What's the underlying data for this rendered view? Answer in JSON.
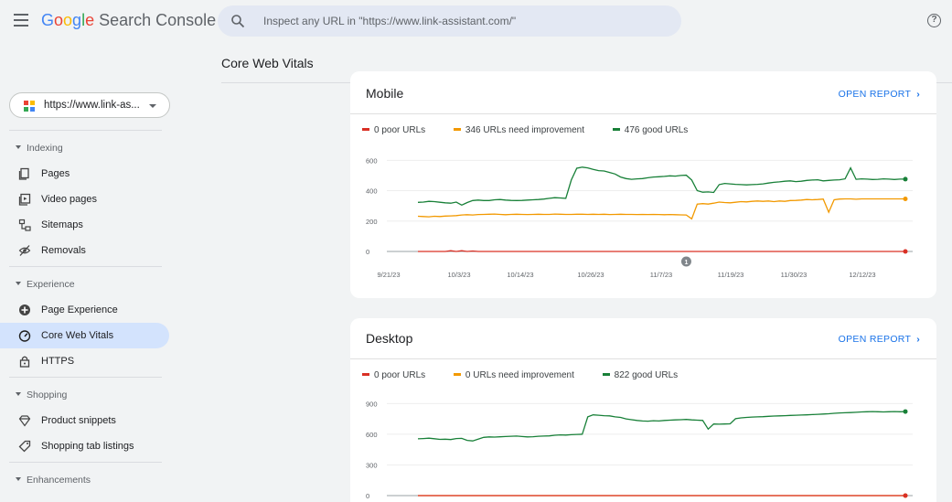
{
  "header": {
    "logo_google": "Google",
    "logo_product": "Search Console",
    "search_placeholder": "Inspect any URL in \"https://www.link-assistant.com/\"",
    "help_glyph": "?"
  },
  "page_title": "Core Web Vitals",
  "sidebar": {
    "property": "https://www.link-as...",
    "sections": [
      {
        "label": "Indexing",
        "items": [
          {
            "label": "Pages",
            "icon": "pages-icon"
          },
          {
            "label": "Video pages",
            "icon": "video-pages-icon"
          },
          {
            "label": "Sitemaps",
            "icon": "sitemaps-icon"
          },
          {
            "label": "Removals",
            "icon": "removals-icon"
          }
        ]
      },
      {
        "label": "Experience",
        "items": [
          {
            "label": "Page Experience",
            "icon": "page-experience-icon"
          },
          {
            "label": "Core Web Vitals",
            "icon": "speedometer-icon",
            "active": true
          },
          {
            "label": "HTTPS",
            "icon": "lock-icon"
          }
        ]
      },
      {
        "label": "Shopping",
        "items": [
          {
            "label": "Product snippets",
            "icon": "diamond-icon"
          },
          {
            "label": "Shopping tab listings",
            "icon": "tag-icon"
          }
        ]
      },
      {
        "label": "Enhancements",
        "items": []
      }
    ]
  },
  "colors": {
    "poor": "#d93025",
    "needs_improvement": "#f29900",
    "good": "#188038",
    "accent": "#1a73e8",
    "active_nav": "#d3e3fd"
  },
  "cards": [
    {
      "title": "Mobile",
      "open_report": "OPEN REPORT",
      "legend": [
        "0 poor URLs",
        "346 URLs need improvement",
        "476 good URLs"
      ],
      "annotation": "1",
      "chart_data": {
        "type": "line",
        "x_ticks": [
          "9/21/23",
          "10/3/23",
          "10/14/23",
          "10/26/23",
          "11/7/23",
          "11/19/23",
          "11/30/23",
          "12/12/23"
        ],
        "y_ticks": [
          0,
          200,
          400,
          600
        ],
        "ylim": [
          0,
          620
        ],
        "annotation_index": 49,
        "series": [
          {
            "name": "0 poor URLs",
            "color": "#d93025",
            "values": [
              0,
              0,
              0,
              0,
              0,
              0,
              5,
              0,
              5,
              0,
              3,
              0,
              0,
              0,
              0,
              0,
              0,
              0,
              0,
              0,
              0,
              0,
              0,
              0,
              0,
              0,
              0,
              0,
              0,
              0,
              0,
              0,
              0,
              0,
              0,
              0,
              0,
              0,
              0,
              0,
              0,
              0,
              0,
              0,
              0,
              0,
              0,
              0,
              0,
              0,
              0,
              0,
              0,
              0,
              0,
              0,
              0,
              0,
              0,
              0,
              0,
              0,
              0,
              0,
              0,
              0,
              0,
              0,
              0,
              0,
              0,
              0,
              0,
              0,
              0,
              0,
              0,
              0,
              0,
              0,
              0,
              0,
              0,
              0,
              0,
              0,
              0,
              0,
              0,
              0
            ]
          },
          {
            "name": "346 URLs need improvement",
            "color": "#f29900",
            "values": [
              232,
              230,
              228,
              232,
              230,
              233,
              234,
              236,
              240,
              242,
              240,
              243,
              244,
              245,
              246,
              244,
              242,
              244,
              245,
              244,
              243,
              244,
              245,
              244,
              244,
              246,
              245,
              244,
              244,
              245,
              245,
              244,
              245,
              244,
              245,
              243,
              244,
              245,
              244,
              244,
              243,
              244,
              243,
              244,
              243,
              242,
              243,
              242,
              241,
              240,
              215,
              312,
              315,
              312,
              318,
              325,
              322,
              320,
              324,
              328,
              326,
              330,
              332,
              330,
              332,
              328,
              332,
              330,
              335,
              336,
              338,
              342,
              340,
              342,
              345,
              258,
              340,
              345,
              346,
              346,
              344,
              346,
              346,
              346,
              346,
              346,
              346,
              346,
              346,
              346
            ]
          },
          {
            "name": "476 good URLs",
            "color": "#188038",
            "values": [
              323,
              325,
              330,
              328,
              324,
              320,
              318,
              325,
              305,
              322,
              335,
              338,
              335,
              335,
              340,
              342,
              338,
              336,
              335,
              336,
              338,
              340,
              342,
              345,
              350,
              354,
              352,
              350,
              470,
              548,
              555,
              550,
              540,
              532,
              530,
              520,
              510,
              490,
              480,
              475,
              478,
              480,
              485,
              490,
              492,
              494,
              498,
              496,
              500,
              502,
              470,
              400,
              390,
              392,
              388,
              440,
              448,
              445,
              442,
              440,
              438,
              440,
              442,
              445,
              450,
              455,
              458,
              462,
              465,
              460,
              462,
              468,
              470,
              472,
              465,
              468,
              470,
              472,
              478,
              550,
              475,
              478,
              476,
              474,
              475,
              478,
              476,
              474,
              476,
              476
            ]
          }
        ]
      }
    },
    {
      "title": "Desktop",
      "open_report": "OPEN REPORT",
      "legend": [
        "0 poor URLs",
        "0 URLs need improvement",
        "822 good URLs"
      ],
      "chart_data": {
        "type": "line",
        "y_ticks": [
          0,
          300,
          600,
          900
        ],
        "ylim": [
          0,
          930
        ],
        "series": [
          {
            "name": "0 poor URLs",
            "color": "#d93025",
            "values": [
              0,
              0,
              0,
              0,
              0,
              0,
              0,
              0,
              0,
              0,
              0,
              0,
              0,
              0,
              0,
              0,
              0,
              0,
              0,
              0,
              0,
              0,
              0,
              0,
              0,
              0,
              0,
              0,
              0,
              0,
              0,
              0,
              0,
              0,
              0,
              0,
              0,
              0,
              0,
              0,
              0,
              0,
              0,
              0,
              0,
              0,
              0,
              0,
              0,
              0,
              0,
              0,
              0,
              0,
              0,
              0,
              0,
              0,
              0,
              0,
              0,
              0,
              0,
              0,
              0,
              0,
              0,
              0,
              0,
              0,
              0,
              0,
              0,
              0,
              0,
              0,
              0,
              0,
              0,
              0,
              0,
              0,
              0,
              0,
              0,
              0,
              0,
              0,
              0,
              0
            ]
          },
          {
            "name": "0 URLs need improvement",
            "color": "#f29900",
            "values": [
              0,
              0,
              0,
              0,
              0,
              0,
              0,
              0,
              0,
              0,
              0,
              0,
              0,
              0,
              0,
              0,
              0,
              0,
              0,
              0,
              0,
              0,
              0,
              0,
              0,
              0,
              0,
              0,
              0,
              0,
              0,
              0,
              0,
              0,
              0,
              0,
              0,
              0,
              0,
              0,
              0,
              0,
              0,
              0,
              0,
              0,
              0,
              0,
              0,
              0,
              0,
              0,
              0,
              0,
              0,
              0,
              0,
              0,
              0,
              0,
              0,
              0,
              0,
              0,
              0,
              0,
              0,
              0,
              0,
              0,
              0,
              0,
              0,
              0,
              0,
              0,
              0,
              0,
              0,
              0,
              0,
              0,
              0,
              0,
              0,
              0,
              0,
              0,
              0,
              0
            ]
          },
          {
            "name": "822 good URLs",
            "color": "#188038",
            "values": [
              555,
              558,
              562,
              556,
              550,
              552,
              548,
              558,
              560,
              540,
              535,
              552,
              570,
              574,
              572,
              575,
              578,
              580,
              582,
              578,
              574,
              576,
              580,
              582,
              584,
              590,
              594,
              592,
              596,
              598,
              600,
              770,
              790,
              786,
              782,
              780,
              770,
              765,
              750,
              742,
              735,
              730,
              728,
              732,
              730,
              735,
              738,
              740,
              742,
              745,
              740,
              738,
              735,
              650,
              700,
              698,
              700,
              702,
              752,
              760,
              765,
              768,
              770,
              772,
              775,
              778,
              780,
              782,
              784,
              786,
              788,
              790,
              792,
              795,
              798,
              800,
              805,
              808,
              810,
              812,
              815,
              818,
              820,
              822,
              820,
              818,
              820,
              822,
              820,
              822
            ]
          }
        ]
      }
    }
  ]
}
